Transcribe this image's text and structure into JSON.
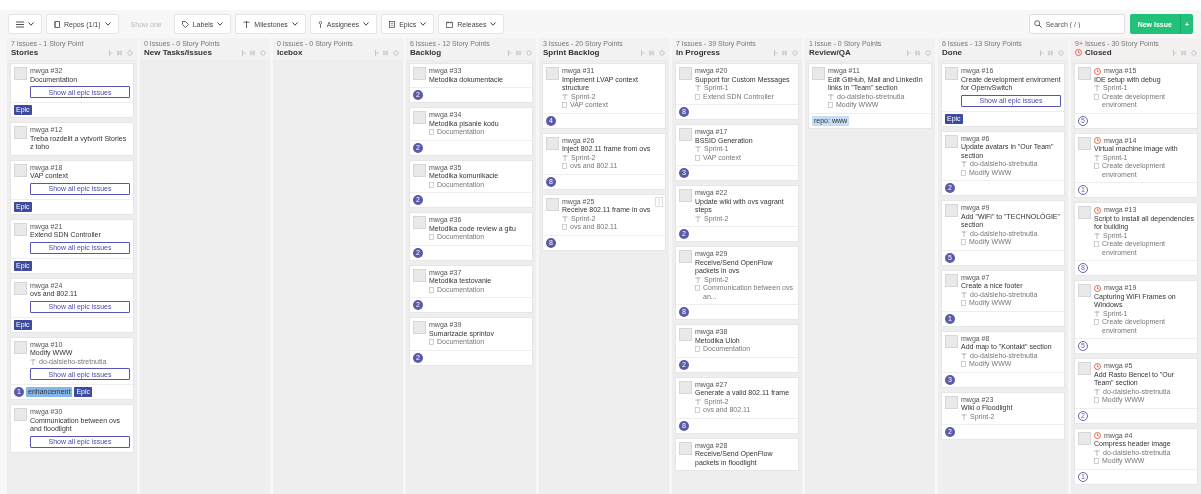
{
  "toolbar": {
    "filters": [
      {
        "label": "Repos (1/1)",
        "disabled": false
      },
      {
        "label": "Show one",
        "disabled": true
      },
      {
        "label": "Labels",
        "disabled": false
      },
      {
        "label": "Milestones",
        "disabled": false
      },
      {
        "label": "Assignees",
        "disabled": false
      },
      {
        "label": "Epics",
        "disabled": false
      },
      {
        "label": "Releases",
        "disabled": false
      }
    ],
    "search": {
      "placeholder": "Search ( / )"
    },
    "new_issue": "New Issue",
    "new_issue_more": "+"
  },
  "columns": [
    {
      "summary": "7 Issues - 1 Story Point",
      "title": "Stories",
      "closed": false,
      "cards": [
        {
          "ref": "mwga #32",
          "title": "Documentation",
          "epic_button": "Show all epic issues",
          "labels": [
            {
              "text": "Epic",
              "color": "#3e4a9e"
            }
          ]
        },
        {
          "ref": "mwga #12",
          "title": "Treba rozdelit a vytvorit Stories z toho"
        },
        {
          "ref": "mwga #18",
          "title": "VAP context",
          "epic_button": "Show all epic issues",
          "labels": [
            {
              "text": "Epic",
              "color": "#3e4a9e"
            }
          ]
        },
        {
          "ref": "mwga #21",
          "title": "Extend SDN Controller",
          "epic_button": "Show all epic issues",
          "labels": [
            {
              "text": "Epic",
              "color": "#3e4a9e"
            }
          ]
        },
        {
          "ref": "mwga #24",
          "title": "ovs and 802.11",
          "epic_button": "Show all epic issues",
          "labels": [
            {
              "text": "Epic",
              "color": "#3e4a9e"
            }
          ]
        },
        {
          "ref": "mwga #10",
          "title": "Modify WWW",
          "milestone": "do-dalsieho-stretnutia",
          "epic_button": "Show all epic issues",
          "estimate": "1",
          "labels": [
            {
              "text": "enhancement",
              "color": "#84b6eb"
            },
            {
              "text": "Epic",
              "color": "#3e4a9e"
            }
          ]
        },
        {
          "ref": "mwga #30",
          "title": "Communication between ovs and floodlight",
          "epic_button": "Show all epic issues"
        }
      ]
    },
    {
      "summary": "0 Issues - 0 Story Points",
      "title": "New Tasks/Issues",
      "closed": false
    },
    {
      "summary": "0 Issues - 0 Story Points",
      "title": "Icebox",
      "closed": false
    },
    {
      "summary": "6 Issues - 12 Story Points",
      "title": "Backlog",
      "closed": false,
      "cards": [
        {
          "ref": "mwga #33",
          "title": "Metodika dokumentacie",
          "estimate": "2"
        },
        {
          "ref": "mwga #34",
          "title": "Metodika pisanie kodu",
          "epic": "Documentation",
          "estimate": "2"
        },
        {
          "ref": "mwga #35",
          "title": "Metodika komunikacie",
          "epic": "Documentation",
          "estimate": "2"
        },
        {
          "ref": "mwga #36",
          "title": "Metodika code review a gitu",
          "epic": "Documentation",
          "estimate": "2"
        },
        {
          "ref": "mwga #37",
          "title": "Metodika testovanie",
          "epic": "Documentation",
          "estimate": "2"
        },
        {
          "ref": "mwga #39",
          "title": "Sumarizacie sprintov",
          "epic": "Documentation",
          "estimate": "2"
        }
      ]
    },
    {
      "summary": "3 Issues - 20 Story Points",
      "title": "Sprint Backlog",
      "closed": false,
      "cards": [
        {
          "ref": "mwga #31",
          "title": "Implement LVAP context structure",
          "milestone": "Sprint-2",
          "epic": "VAP context",
          "estimate": "4"
        },
        {
          "ref": "mwga #26",
          "title": "Inject 802.11 frame from ovs",
          "milestone": "Sprint-2",
          "epic": "ovs and 802.11",
          "estimate": "8"
        },
        {
          "ref": "mwga #25",
          "title": "Receive 802.11 frame in ovs",
          "milestone": "Sprint-2",
          "epic": "ovs and 802.11",
          "estimate": "8",
          "menu": true
        }
      ]
    },
    {
      "summary": "7 Issues - 39 Story Points",
      "title": "In Progress",
      "closed": false,
      "cards": [
        {
          "ref": "mwga #20",
          "title": "Support for Custom Messages",
          "milestone": "Sprint-1",
          "epic": "Extend SDN Controller",
          "estimate": "8"
        },
        {
          "ref": "mwga #17",
          "title": "BSSID Generation",
          "milestone": "Sprint-1",
          "epic": "VAP context",
          "estimate": "3"
        },
        {
          "ref": "mwga #22",
          "title": "Update wiki with ovs vagrant steps",
          "milestone": "Sprint-2",
          "estimate": "2"
        },
        {
          "ref": "mwga #29",
          "title": "Receive/Send OpenFlow packets in ovs",
          "milestone": "Sprint-2",
          "epic": "Communication between ovs an...",
          "estimate": "8"
        },
        {
          "ref": "mwga #38",
          "title": "Metodika Uloh",
          "epic": "Documentation",
          "estimate": "2"
        },
        {
          "ref": "mwga #27",
          "title": "Generate a valid 802.11 frame",
          "milestone": "Sprint-2",
          "epic": "ovs and 802.11",
          "estimate": "8"
        },
        {
          "ref": "mwga #28",
          "title": "Receive/Send OpenFlow packets in floodlight"
        }
      ]
    },
    {
      "summary": "1 Issue - 0 Story Points",
      "title": "Review/QA",
      "closed": false,
      "cards": [
        {
          "ref": "mwga #11",
          "title": "Edit GitHub, Mail and LinkedIn links in \"Team\" section",
          "milestone": "do-dalsieho-stretnutia",
          "epic": "Modify WWW",
          "labels": [
            {
              "text": "repo: www",
              "color": "#c5def5"
            }
          ]
        }
      ]
    },
    {
      "summary": "6 Issues - 13 Story Points",
      "title": "Done",
      "closed": false,
      "cards": [
        {
          "ref": "mwga #16",
          "title": "Create development enviroment for OpenvSwitch",
          "epic_button": "Show all epic issues",
          "labels": [
            {
              "text": "Epic",
              "color": "#3e4a9e"
            }
          ]
        },
        {
          "ref": "mwga #6",
          "title": "Update avatars in \"Our Team\" section",
          "milestone": "do-dalsieho-stretnutia",
          "epic": "Modify WWW",
          "estimate": "2"
        },
        {
          "ref": "mwga #9",
          "title": "Add \"WiFi\" to \"TECHNOLÓGIE\" section",
          "milestone": "do-dalsieho-stretnutia",
          "epic": "Modify WWW",
          "estimate": "5"
        },
        {
          "ref": "mwga #7",
          "title": "Create a nice footer",
          "milestone": "do-dalsieho-stretnutia",
          "epic": "Modify WWW",
          "estimate": "1"
        },
        {
          "ref": "mwga #8",
          "title": "Add map to \"Kontakt\" section",
          "milestone": "do-dalsieho-stretnutia",
          "epic": "Modify WWW",
          "estimate": "3"
        },
        {
          "ref": "mwga #23",
          "title": "Wiki o Floodlight",
          "milestone": "Sprint-2",
          "estimate": "2"
        }
      ]
    },
    {
      "summary": "9+ Issues - 30 Story Points",
      "title": "Closed",
      "closed": true,
      "cards": [
        {
          "ref": "mwga #15",
          "title": "IDE setup with debug",
          "closed": true,
          "milestone": "Sprint-1",
          "epic": "Create development enviroment",
          "estimate": "5"
        },
        {
          "ref": "mwga #14",
          "title": "Virtual machine image with",
          "closed": true,
          "milestone": "Sprint-1",
          "epic": "Create development enviroment",
          "estimate": "1"
        },
        {
          "ref": "mwga #13",
          "title": "Script to install all dependencies for building",
          "closed": true,
          "milestone": "Sprint-1",
          "epic": "Create development enviroment",
          "estimate": "8"
        },
        {
          "ref": "mwga #19",
          "title": "Capturing WiFi Frames on Windows",
          "closed": true,
          "milestone": "Sprint-1",
          "epic": "Create development enviroment",
          "estimate": "5"
        },
        {
          "ref": "mwga #5",
          "title": "Add Rasto Bencel to \"Our Team\" section",
          "closed": true,
          "milestone": "do-dalsieho-stretnutia",
          "epic": "Modify WWW",
          "estimate": "2"
        },
        {
          "ref": "mwga #4",
          "title": "Compress header image",
          "closed": true,
          "milestone": "do-dalsieho-stretnutia",
          "epic": "Modify WWW",
          "estimate": "1"
        }
      ]
    }
  ]
}
